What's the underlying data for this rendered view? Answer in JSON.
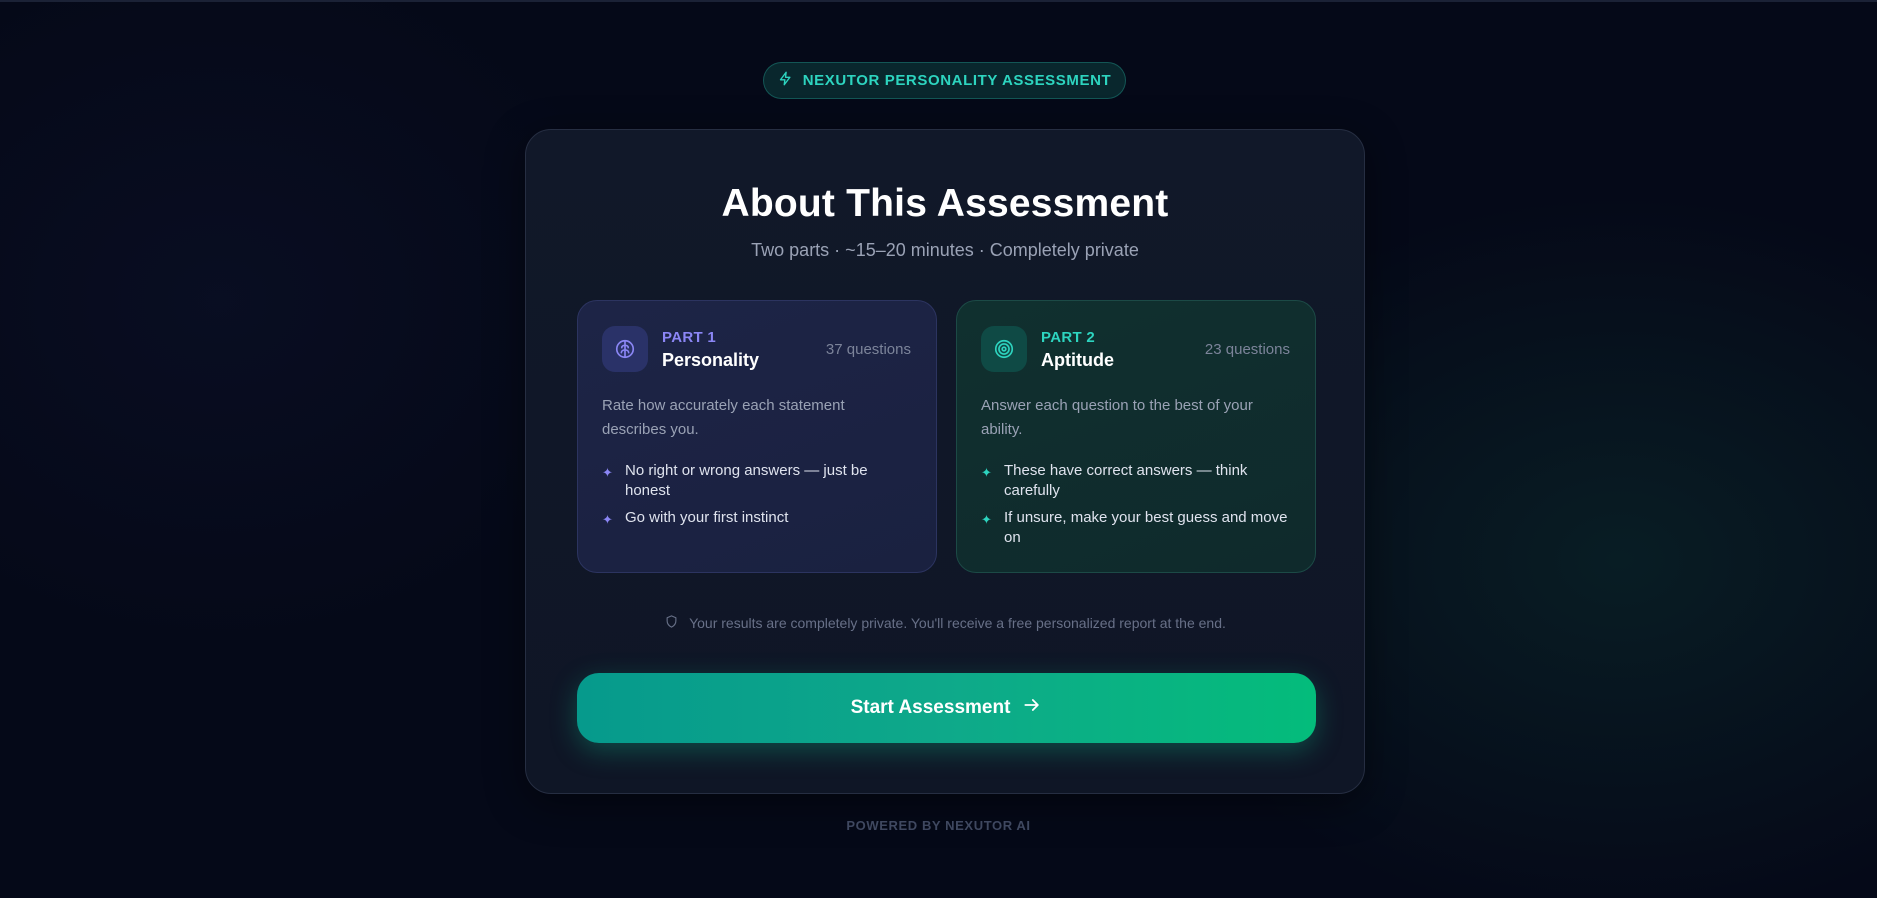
{
  "badge": {
    "label": "NEXUTOR PERSONALITY ASSESSMENT",
    "icon": "bolt-icon"
  },
  "card": {
    "title": "About This Assessment",
    "subtitle": "Two parts · ~15–20 minutes · Completely private"
  },
  "parts": [
    {
      "tag": "PART 1",
      "name": "Personality",
      "count": "37 questions",
      "icon": "brain-icon",
      "description": "Rate how accurately each statement describes you.",
      "bullets": [
        "No right or wrong answers — just be honest",
        "Go with your first instinct"
      ],
      "accent": "#8b86f5"
    },
    {
      "tag": "PART 2",
      "name": "Aptitude",
      "count": "23 questions",
      "icon": "target-icon",
      "description": "Answer each question to the best of your ability.",
      "bullets": [
        "These have correct answers — think carefully",
        "If unsure, make your best guess and move on"
      ],
      "accent": "#2dd4bf"
    }
  ],
  "privacy": {
    "text": "Your results are completely private. You'll receive a free personalized report at the end.",
    "icon": "shield-icon"
  },
  "start_button": {
    "label": "Start Assessment",
    "icon": "arrow-right-icon"
  },
  "footer": {
    "text": "POWERED BY NEXUTOR AI"
  },
  "colors": {
    "background": "#050918",
    "accent_teal": "#2dd4bf",
    "accent_violet": "#8b86f5",
    "button_green": "#04bc7b"
  }
}
